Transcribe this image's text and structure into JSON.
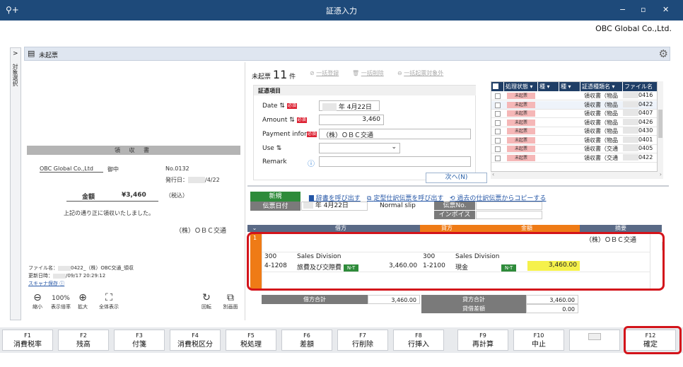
{
  "window": {
    "title": "証憑入力",
    "app_icon": "search-plus-icon",
    "controls": [
      "−",
      "▫",
      "✕"
    ]
  },
  "company": "OBC Global Co.,Ltd.",
  "side_tab": "対象選択",
  "side_tab_arrow": ">",
  "header": {
    "label": "未起票",
    "gear_icon": "gear-icon"
  },
  "receipt": {
    "title": "領 収 書",
    "to": "OBC Global Co.,Ltd",
    "to_suffix": "御中",
    "no": "No.0132",
    "issue_label": "発行日：",
    "issue_date": "/4/22",
    "amount_label": "金額",
    "amount": "¥3,460",
    "tax": "（税込）",
    "note": "上記の通り正に領収いたしました。",
    "issuer": "（株）ＯＢＣ交通",
    "file_label": "ファイル名：",
    "file_name": "0422_（株）OBC交通_領収",
    "updated_label": "更新日時：",
    "updated": "/09/17 20:29:12",
    "scanner_link": "スキャナ保存"
  },
  "preview_tools": {
    "zoom_out": "縮小",
    "zoom_pct": "100%",
    "zoom_label": "表示倍率",
    "zoom_in": "拡大",
    "fit": "全体表示",
    "rotate": "回転",
    "separate": "別画面"
  },
  "slip": {
    "status_label": "未起票",
    "count": "11",
    "count_unit": "件",
    "toolbar": [
      "一括登録",
      "一括削除",
      "一括起票対象外"
    ],
    "section": "証憑項目",
    "required": "必須",
    "date_label": "Date",
    "date_value": "年 4月22日",
    "amount_label": "Amount",
    "amount_value": "3,460",
    "payment_label": "Payment infor",
    "payment_value": "（株）ＯＢＣ交通",
    "use_label": "Use",
    "use_value": "",
    "remark_label": "Remark",
    "remark_value": "",
    "next_button": "次へ(N)"
  },
  "grid": {
    "headers": [
      "処理状態",
      "種",
      "種",
      "証憑種類名",
      "ファイル名"
    ],
    "rows": [
      {
        "status": "未起票",
        "type": "領収書（物品",
        "file": "0416"
      },
      {
        "status": "未起票",
        "type": "領収書（物品",
        "file": "0422"
      },
      {
        "status": "未起票",
        "type": "領収書（物品",
        "file": "0407"
      },
      {
        "status": "未起票",
        "type": "領収書（物品",
        "file": "0426"
      },
      {
        "status": "未起票",
        "type": "領収書（物品",
        "file": "0430"
      },
      {
        "status": "未起票",
        "type": "領収書（物品",
        "file": "0401"
      },
      {
        "status": "未起票",
        "type": "領収書（交通",
        "file": "0405"
      },
      {
        "status": "未起票",
        "type": "領収書（交通",
        "file": "0422"
      }
    ]
  },
  "journal": {
    "new_button": "新規",
    "links": [
      "辞書を呼び出す",
      "定型仕訳伝票を呼び出す",
      "過去の仕訳伝票からコピーする"
    ],
    "slip_date_label": "伝票日付",
    "slip_date": "年  4月22日",
    "slip_type": "Normal slip",
    "slip_no_label": "伝票No.",
    "invoice_label": "インボイスNo.",
    "headers": {
      "debit": "借方",
      "credit": "貸方",
      "amount": "金額",
      "memo": "摘要"
    },
    "row_no": "1",
    "memo": "（株）ＯＢＣ交通",
    "debit_code": "300",
    "debit_dept": "Sales Division",
    "debit_sub": "4-1208",
    "debit_account": "旅費及び交際費",
    "tax_tag": "N-T",
    "debit_amount": "3,460.00",
    "credit_code": "300",
    "credit_dept": "Sales Division",
    "credit_sub": "1-2100",
    "credit_account": "現金",
    "credit_tag": "N-T",
    "credit_amount": "3,460.00",
    "debit_total_label": "借方合計",
    "debit_total": "3,460.00",
    "credit_total_label": "貸方合計",
    "credit_total": "3,460.00",
    "diff_label": "貸借差額",
    "diff": "0.00"
  },
  "fkeys": [
    {
      "key": "F1",
      "label": "消費税率"
    },
    {
      "key": "F2",
      "label": "残高"
    },
    {
      "key": "F3",
      "label": "付箋"
    },
    {
      "key": "F4",
      "label": "消費税区分"
    },
    {
      "key": "F5",
      "label": "税処理"
    },
    {
      "key": "F6",
      "label": "差額"
    },
    {
      "key": "F7",
      "label": "行削除"
    },
    {
      "key": "F8",
      "label": "行挿入"
    },
    {
      "key": "F9",
      "label": "再計算"
    },
    {
      "key": "F10",
      "label": "中止"
    },
    {
      "key": "",
      "label": ""
    },
    {
      "key": "F12",
      "label": "確定"
    }
  ]
}
